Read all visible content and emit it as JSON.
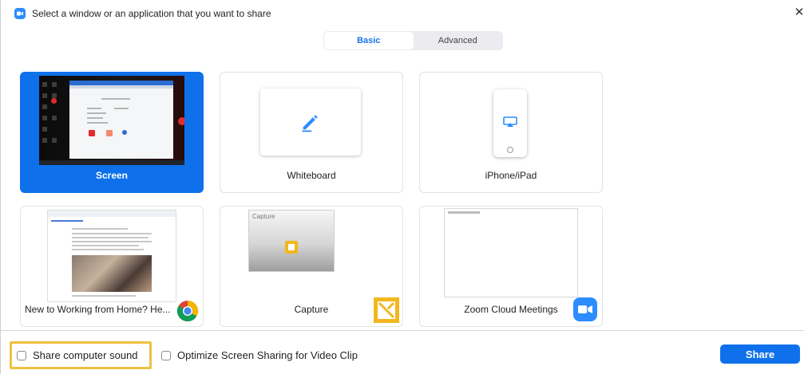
{
  "window": {
    "title": "Select a window or an application that you want to share"
  },
  "tabs": [
    {
      "label": "Basic",
      "active": true
    },
    {
      "label": "Advanced",
      "active": false
    }
  ],
  "tiles": [
    {
      "label": "Screen",
      "selected": true
    },
    {
      "label": "Whiteboard"
    },
    {
      "label": "iPhone/iPad"
    },
    {
      "label": "New to Working from Home? He..."
    },
    {
      "label": "Capture",
      "thumbnail_title": "Capture"
    },
    {
      "label": "Zoom Cloud Meetings"
    }
  ],
  "footer": {
    "share_sound_label": "Share computer sound",
    "optimize_label": "Optimize Screen Sharing for Video Clip",
    "share_button": "Share"
  },
  "colors": {
    "accent": "#0e71eb",
    "highlight": "#f0c040",
    "zoom_blue": "#2d8cff"
  }
}
